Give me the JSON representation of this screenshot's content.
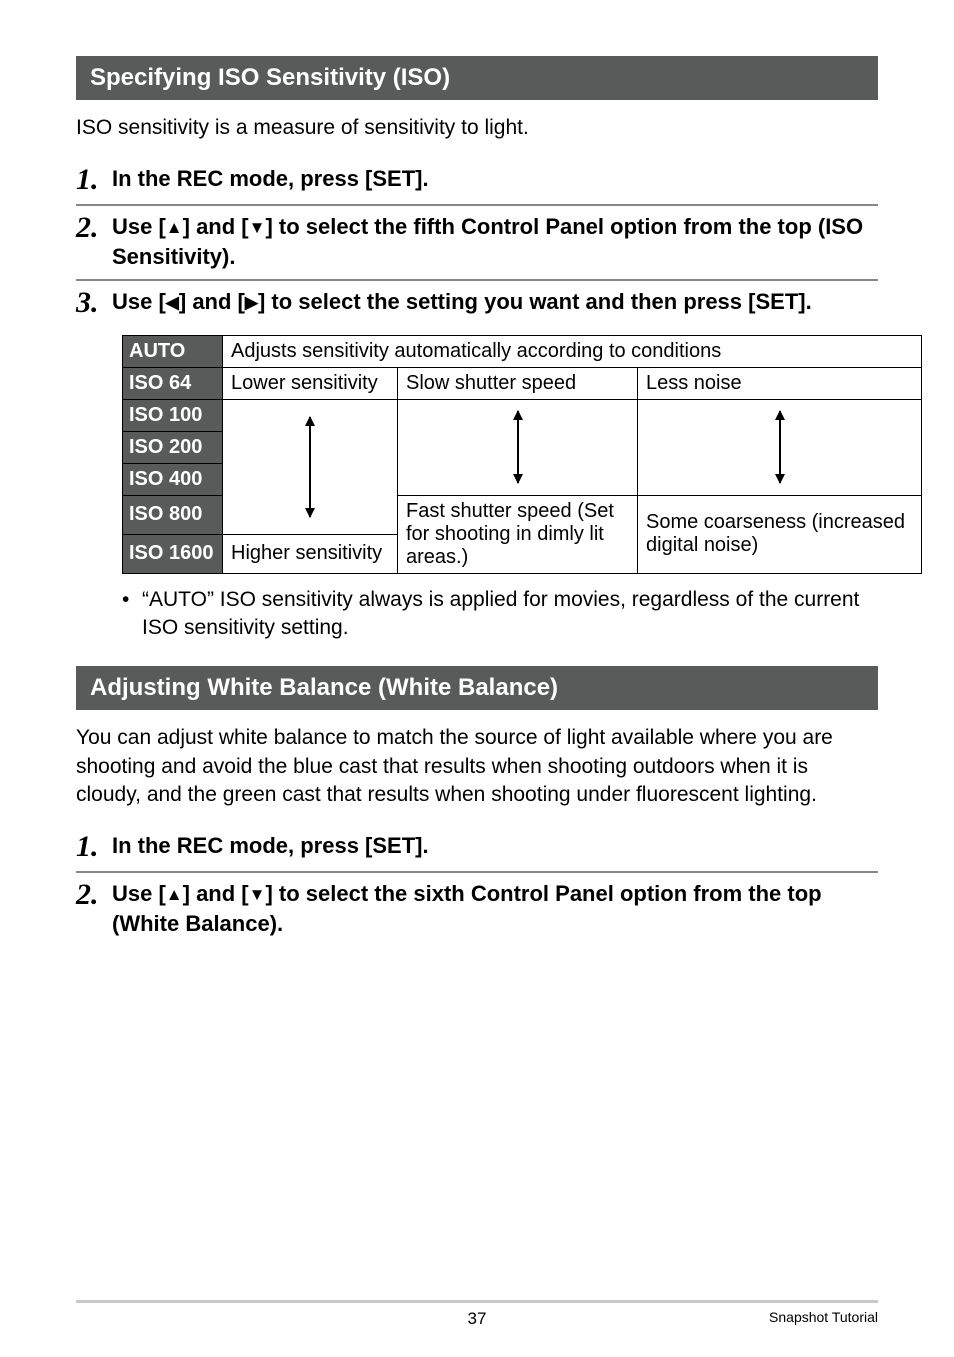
{
  "sections": {
    "iso": {
      "title": "Specifying ISO Sensitivity (ISO)",
      "intro": "ISO sensitivity is a measure of sensitivity to light.",
      "steps": [
        {
          "num": "1.",
          "text_parts": [
            "In the REC mode, press [SET]."
          ]
        },
        {
          "num": "2.",
          "text_parts": [
            "Use [",
            "▲",
            "] and [",
            "▼",
            "] to select the fifth Control Panel option from the top (ISO Sensitivity)."
          ]
        },
        {
          "num": "3.",
          "text_parts": [
            "Use [",
            "◀",
            "] and [",
            "▶",
            "] to select the setting you want and then press [SET]."
          ]
        }
      ],
      "table": {
        "auto_label": "AUTO",
        "auto_desc": "Adjusts sensitivity automatically according to conditions",
        "rows": [
          "ISO 64",
          "ISO 100",
          "ISO 200",
          "ISO 400",
          "ISO 800",
          "ISO 1600"
        ],
        "sens_low": "Lower sensitivity",
        "sens_high": "Higher sensitivity",
        "shutter_slow": "Slow shutter speed",
        "shutter_fast": "Fast shutter speed (Set for shooting in dimly lit areas.)",
        "noise_less": "Less noise",
        "noise_more": "Some coarseness (increased digital noise)"
      },
      "note": "“AUTO” ISO sensitivity always is applied for movies, regardless of the current ISO sensitivity setting."
    },
    "wb": {
      "title": "Adjusting White Balance (White Balance)",
      "intro": "You can adjust white balance to match the source of light available where you are shooting and avoid the blue cast that results when shooting outdoors when it is cloudy, and the green cast that results when shooting under fluorescent lighting.",
      "steps": [
        {
          "num": "1.",
          "text_parts": [
            "In the REC mode, press [SET]."
          ]
        },
        {
          "num": "2.",
          "text_parts": [
            "Use [",
            "▲",
            "] and [",
            "▼",
            "] to select the sixth Control Panel option from the top (White Balance)."
          ]
        }
      ]
    }
  },
  "footer": {
    "page": "37",
    "section": "Snapshot Tutorial"
  },
  "chart_data": {
    "type": "table",
    "title": "ISO Sensitivity effects",
    "rows": [
      {
        "setting": "AUTO",
        "description": "Adjusts sensitivity automatically according to conditions"
      },
      {
        "setting": "ISO 64",
        "sensitivity": "Lower sensitivity",
        "shutter": "Slow shutter speed",
        "noise": "Less noise"
      },
      {
        "setting": "ISO 100",
        "sensitivity": "↓",
        "shutter": "↓",
        "noise": "↓"
      },
      {
        "setting": "ISO 200",
        "sensitivity": "↓",
        "shutter": "↓",
        "noise": "↓"
      },
      {
        "setting": "ISO 400",
        "sensitivity": "↓",
        "shutter": "↓",
        "noise": "↓"
      },
      {
        "setting": "ISO 800",
        "sensitivity": "↓",
        "shutter": "Fast shutter speed (Set for shooting in dimly lit areas.)",
        "noise": "Some coarseness (increased digital noise)"
      },
      {
        "setting": "ISO 1600",
        "sensitivity": "Higher sensitivity",
        "shutter": "Fast shutter speed (Set for shooting in dimly lit areas.)",
        "noise": "Some coarseness (increased digital noise)"
      }
    ]
  }
}
